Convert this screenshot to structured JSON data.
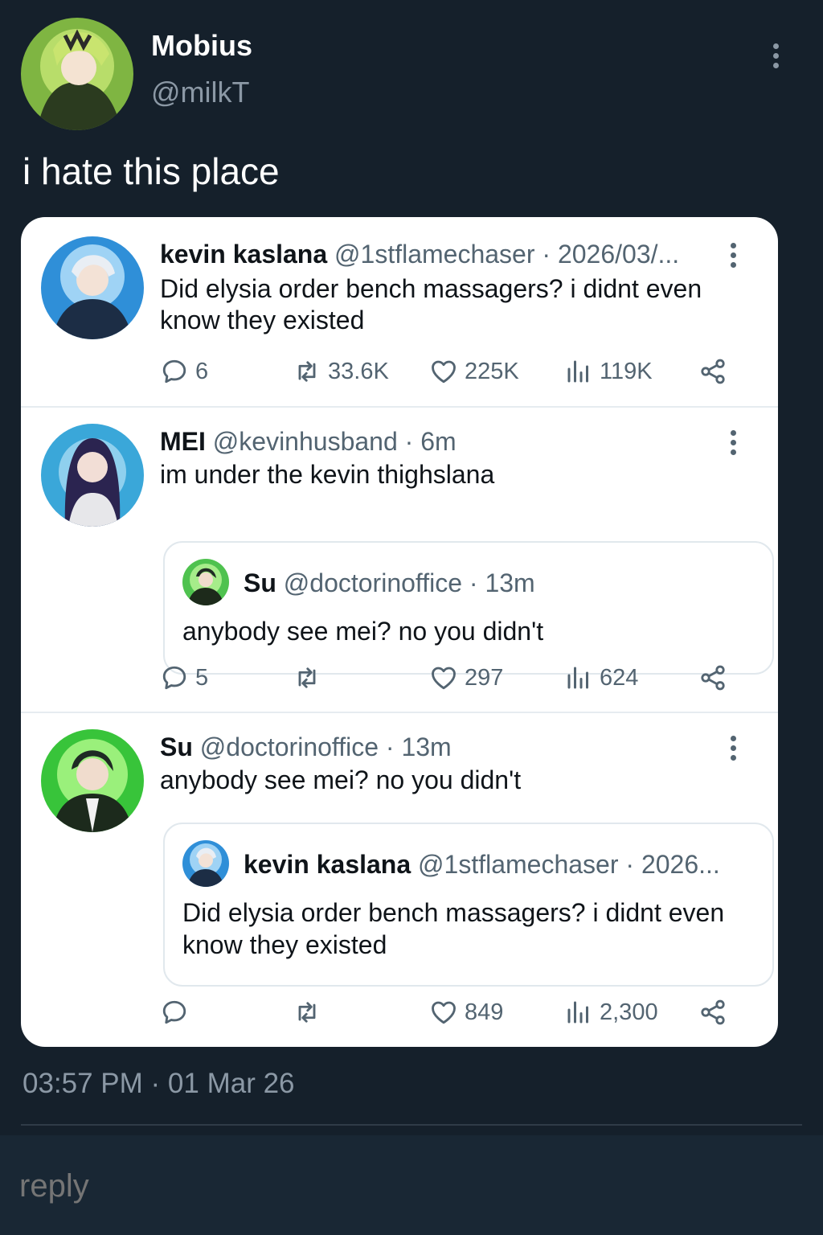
{
  "tweet": {
    "author_name": "Mobius",
    "author_handle": "@milkT",
    "text": "i hate this place",
    "timestamp": "03:57 PM · 01 Mar 26"
  },
  "posts": [
    {
      "name": "kevin kaslana",
      "handle": "@1stflamechaser · 2026/03/...",
      "text": "Did elysia order bench massagers? i didnt even know they existed",
      "replies": "6",
      "reposts": "33.6K",
      "likes": "225K",
      "views": "119K"
    },
    {
      "name": "MEI",
      "handle": "@kevinhusband · 6m",
      "text": "im under the kevin thighslana",
      "quote": {
        "name": "Su",
        "handle": "@doctorinoffice · 13m",
        "text": "anybody see mei? no you didn't"
      },
      "replies": "5",
      "reposts": "",
      "likes": "297",
      "views": "624"
    },
    {
      "name": "Su",
      "handle": "@doctorinoffice · 13m",
      "text": "anybody see mei? no you didn't",
      "quote": {
        "name": "kevin kaslana",
        "handle": "@1stflamechaser · 2026...",
        "text": "Did elysia order bench massagers? i didnt even know they existed"
      },
      "replies": "",
      "reposts": "",
      "likes": "849",
      "views": "2,300"
    }
  ],
  "reply_placeholder": "reply",
  "icons": {
    "reply": "speech-bubble-icon",
    "repost": "repost-arrows-icon",
    "like": "heart-icon",
    "views": "bar-chart-icon",
    "share": "share-nodes-icon",
    "more": "vertical-ellipsis-icon"
  },
  "colors": {
    "background": "#15202b",
    "card": "#ffffff",
    "muted_text": "#8b98a5",
    "card_muted_text": "#536471"
  }
}
